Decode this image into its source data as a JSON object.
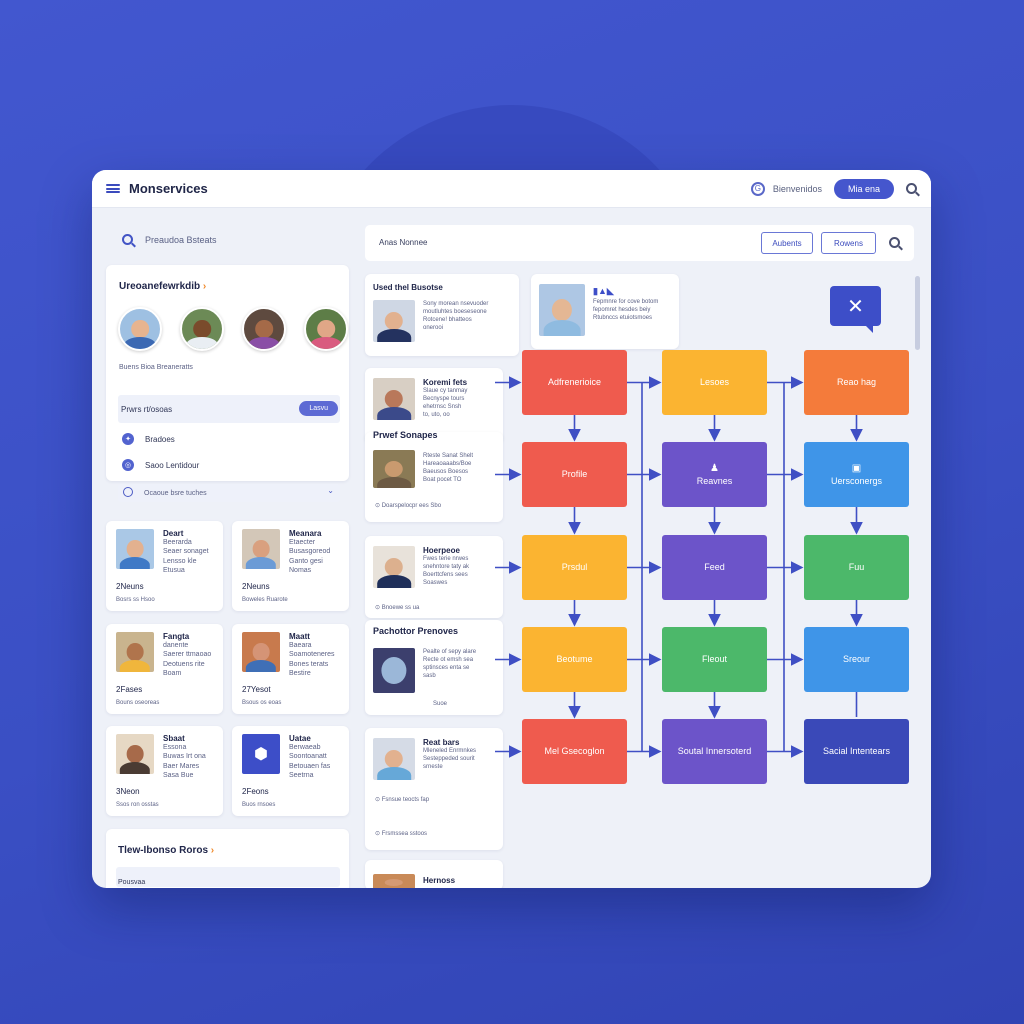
{
  "app": {
    "title": "Monservices",
    "status_label": "Bienvenidos",
    "pill_label": "Mia ena"
  },
  "left": {
    "search_placeholder": "Preaudoa Bsteats",
    "users_card": {
      "title": "Ureoanefewrkdib",
      "caption": "Buens Bioa Breaneratts",
      "filter_label": "Prwrs rt/osoas",
      "filter_button": "Lasvu",
      "row1": "Bradoes",
      "row2": "Saoo Lentidour",
      "select_value": "Ocaoue bsre tuches"
    },
    "profiles": [
      {
        "name": "Deart",
        "l1": "Beerarda",
        "l2": "Seaer sonaget",
        "l3": "Lensso kle",
        "l4": "Etusua",
        "count": "2Neuns",
        "foot": "Bosrs ss Hsoo"
      },
      {
        "name": "Meanara",
        "l1": "Etaecter",
        "l2": "Busasgoreod",
        "l3": "Ganto gesi",
        "l4": "Nomas",
        "count": "2Neuns",
        "foot": "Boweles Ruarote"
      },
      {
        "name": "Fangta",
        "l1": "danente",
        "l2": "Saerer ttmaoao",
        "l3": "Deotuens rite",
        "l4": "Boam",
        "count": "2Fases",
        "foot": "Bouns oseoreas"
      },
      {
        "name": "Maatt",
        "l1": "Baeara",
        "l2": "Soamoteneres",
        "l3": "Bones terats",
        "l4": "Bestire",
        "count": "27Yesot",
        "foot": "Bsous os eoas"
      },
      {
        "name": "Sbaat",
        "l1": "Essona",
        "l2": "Buwas Irt ona",
        "l3": "Baer Mares",
        "l4": "Sasa Bue",
        "count": "3Neon",
        "foot": "Ssos ron osstas"
      },
      {
        "name": "Uatae",
        "l1": "Berwaeab",
        "l2": "Soontoanatt",
        "l3": "Betouaen fas",
        "l4": "Seetrna",
        "count": "2Feons",
        "foot": "Buos rnsoes"
      }
    ],
    "bottom_card": {
      "title": "Tlew-Ibonso Roros",
      "item": "Pousvaa"
    }
  },
  "middle": {
    "search_placeholder": "Anas Nonnee",
    "btn1": "Aubents",
    "btn2": "Rowens",
    "posts": [
      {
        "title": "Used thel Busotse",
        "l1": "Sony morean nsevuoder",
        "l2": "moutluhtes boeseseone",
        "l3": "Rotcene! bhatteos",
        "l4": "onerooi"
      },
      {
        "title": "",
        "l1": "Fepmnre for cove botom",
        "l2": "fepomret hesdes beiy",
        "l3": "Rtubnccs etuiotsmoes",
        "l4": ""
      },
      {
        "title": "Koremi fets",
        "l1": "Slaue cy tanmay",
        "l2": "Becnyspe tours",
        "l3": "ehetrnsc Snsh",
        "l4": "to, uto, oo"
      },
      {
        "title": "Prwef Sonapes",
        "l1": "Rteste Sanat Shelt",
        "l2": "Hareaoaaabs/Boe",
        "l3": "Baeusos Boesos",
        "l4": "Boat pocet TO",
        "foot": "Doarspelocpr ees Sbo"
      },
      {
        "title": "Hoerpeoe",
        "l1": "Fwes terie nrwes",
        "l2": "snehntore taty ak",
        "l3": "Boerttcfens sees",
        "l4": "Soaswes",
        "foot": "Bnoewe ss ua"
      },
      {
        "title": "Pachottor Prenoves",
        "l1": "Pealte of sepy alare",
        "l2": "Recte ot emsh sea",
        "l3": "sptinsces enta se",
        "l4": "sasb",
        "foot": "Suoe"
      },
      {
        "title": "Reat bars",
        "l1": "Mleneled Enrmnkes",
        "l2": "Sesteppeded sourit",
        "l3": "srneste",
        "foot": "Fsnsue teocts fap",
        "foot2": "Frsmssea sstoos"
      },
      {
        "title": "Hernoss"
      }
    ]
  },
  "flow": {
    "nodes": [
      {
        "id": "n1",
        "label": "Adfrenerioice",
        "color": "#ef5b4e"
      },
      {
        "id": "n2",
        "label": "Lesoes",
        "color": "#fbb431"
      },
      {
        "id": "n3",
        "label": "Reao hag",
        "color": "#f47b3b"
      },
      {
        "id": "n4",
        "label": "Profile",
        "color": "#ef5b4e"
      },
      {
        "id": "n5",
        "label": "Reavnes",
        "color": "#6c54c9",
        "icon": "person-icon"
      },
      {
        "id": "n6",
        "label": "Uersconergs",
        "color": "#3f95e8",
        "icon": "group-icon"
      },
      {
        "id": "n7",
        "label": "Prsdul",
        "color": "#fbb431"
      },
      {
        "id": "n8",
        "label": "Feed",
        "color": "#6c54c9"
      },
      {
        "id": "n9",
        "label": "Fuu",
        "color": "#4cb86a"
      },
      {
        "id": "n10",
        "label": "Beotume",
        "color": "#fbb431"
      },
      {
        "id": "n11",
        "label": "Fleout",
        "color": "#4cb86a"
      },
      {
        "id": "n12",
        "label": "Sreour",
        "color": "#3f95e8"
      },
      {
        "id": "n13",
        "label": "Mel Gsecoglon",
        "color": "#ef5b4e"
      },
      {
        "id": "n14",
        "label": "Soutal Innersoterd",
        "color": "#6c54c9"
      },
      {
        "id": "n15",
        "label": "Sacial Intentears",
        "color": "#3a49b8"
      }
    ],
    "arrow_color": "#3f4fc4"
  }
}
